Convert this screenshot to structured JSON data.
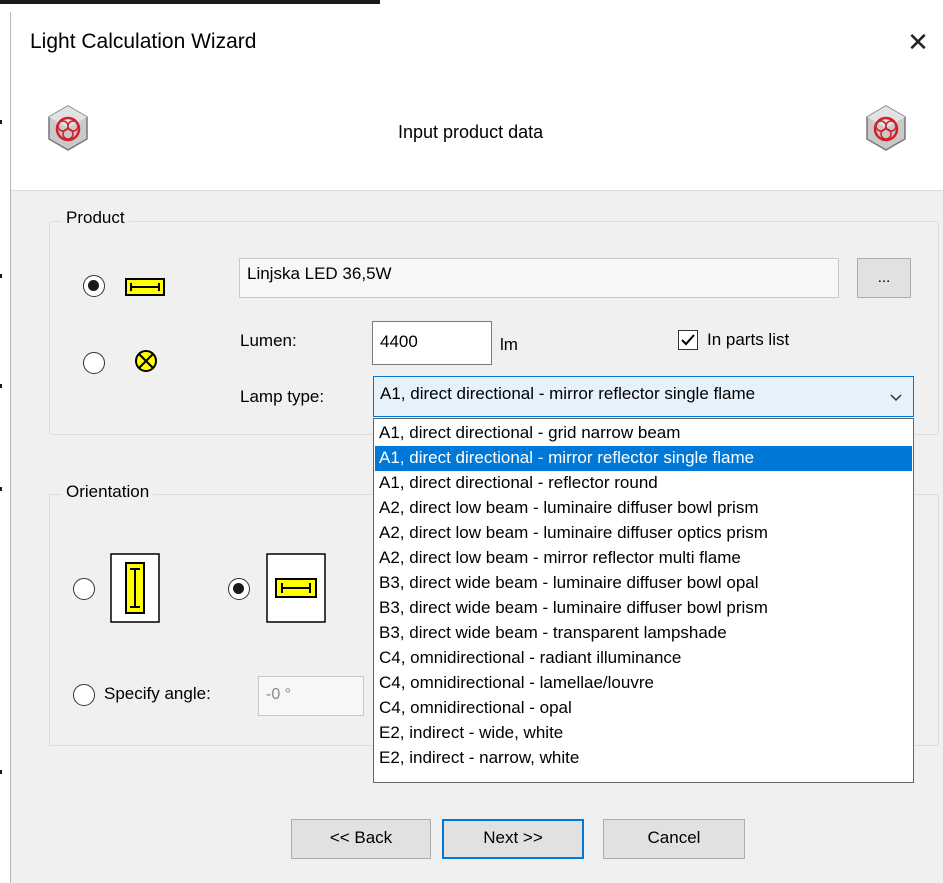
{
  "window": {
    "title": "Light Calculation Wizard",
    "close_glyph": "✕"
  },
  "header": {
    "text": "Input product data",
    "logo_icon": "light-calc-logo-icon"
  },
  "product": {
    "group_label": "Product",
    "name_value": "Linjska LED 36,5W",
    "browse_label": "...",
    "lumen_label": "Lumen:",
    "lumen_value": "4400",
    "lumen_unit": "lm",
    "in_parts_list_label": "In parts list",
    "in_parts_list_checked": true,
    "lamp_type_label": "Lamp type:",
    "lamp_type_selected": "A1, direct directional - mirror reflector single flame",
    "lamp_type_options": [
      "A1, direct directional - grid narrow beam",
      "A1, direct directional - mirror reflector single flame",
      "A1, direct directional - reflector round",
      "A2, direct low beam - luminaire diffuser bowl prism",
      "A2, direct low beam - luminaire diffuser optics prism",
      "A2, direct low beam - mirror reflector multi flame",
      "B3, direct wide beam - luminaire diffuser bowl opal",
      "B3, direct wide beam - luminaire diffuser bowl prism",
      "B3, direct wide beam - transparent lampshade",
      "C4, omnidirectional - radiant illuminance",
      "C4, omnidirectional - lamellae/louvre",
      "C4, omnidirectional - opal",
      "E2, indirect - wide, white",
      "E2, indirect - narrow, white"
    ],
    "selected_option_index": 1
  },
  "orientation": {
    "group_label": "Orientation",
    "specify_angle_label": "Specify angle:",
    "angle_value": "-0 °"
  },
  "buttons": {
    "back": "<< Back",
    "next": "Next >>",
    "cancel": "Cancel"
  },
  "colors": {
    "accent": "#0078d7",
    "lamp_yellow": "#ffff00",
    "selection": "#0078d7"
  }
}
